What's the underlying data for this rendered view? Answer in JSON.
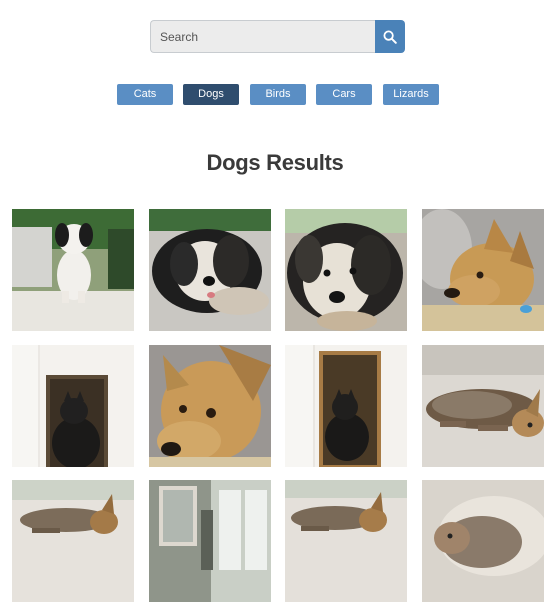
{
  "search": {
    "placeholder": "Search",
    "value": "",
    "icon": "search-icon"
  },
  "categories": [
    {
      "label": "Cats",
      "active": false
    },
    {
      "label": "Dogs",
      "active": true
    },
    {
      "label": "Birds",
      "active": false
    },
    {
      "label": "Cars",
      "active": false
    },
    {
      "label": "Lizards",
      "active": false
    }
  ],
  "results": {
    "title": "Dogs Results"
  },
  "colors": {
    "accent": "#4a82b8",
    "tab": "#5a8ec4",
    "tab_active": "#2f4d6e"
  },
  "images": [
    {
      "subject": "white black puppy standing outdoors"
    },
    {
      "subject": "black white dog lying close-up"
    },
    {
      "subject": "black white dog face close-up"
    },
    {
      "subject": "tan dog on couch"
    },
    {
      "subject": "black cat in cabinet"
    },
    {
      "subject": "tan dog face close-up"
    },
    {
      "subject": "black cat in cabinet"
    },
    {
      "subject": "merle dog lying on tile floor"
    },
    {
      "subject": "dog lying on floor"
    },
    {
      "subject": "room with windows"
    },
    {
      "subject": "dog lying on floor"
    },
    {
      "subject": "merle dog in dog bed"
    }
  ]
}
